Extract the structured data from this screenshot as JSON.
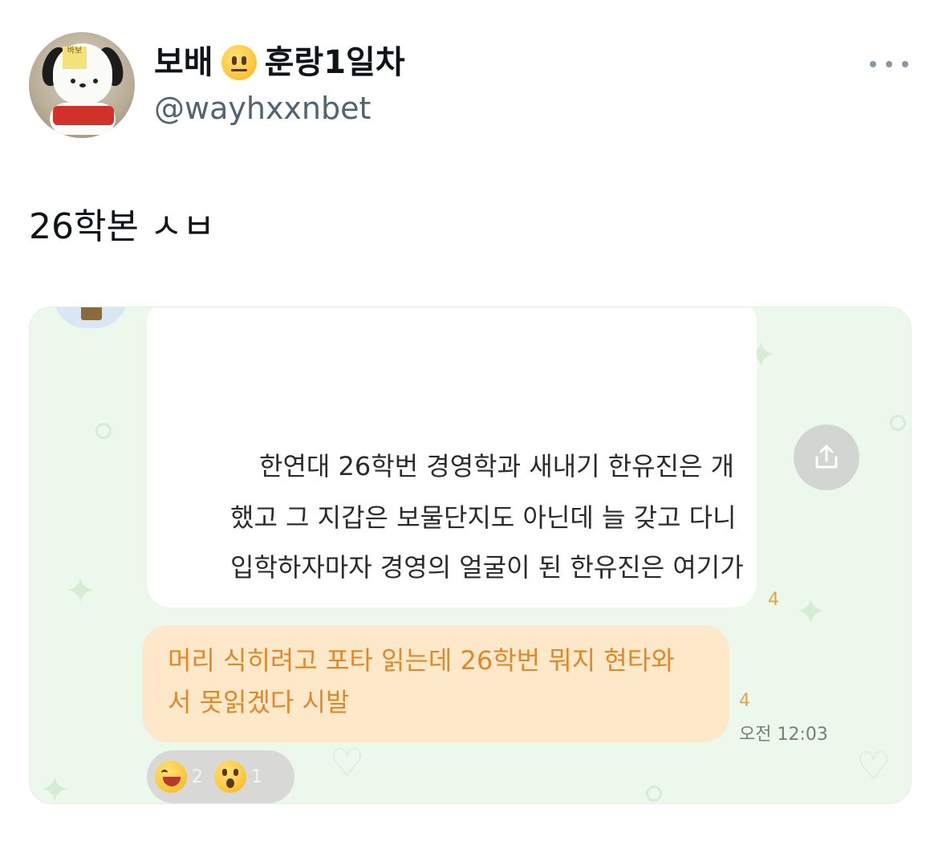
{
  "author": {
    "display_name_part1": "보배",
    "display_name_part2": "훈랑1일차",
    "handle": "@wayhxxnbet",
    "avatar_note_text": "바보"
  },
  "tweet": {
    "text": "26학본 ㅅㅂ"
  },
  "chat": {
    "message_lines": [
      "한연대 26학번 경영학과 새내기 한유진은 개",
      "했고 그 지갑은 보물단지도 아닌데 늘 갖고 다니",
      "입학하자마자 경영의 얼굴이 된 한유진은 여기가"
    ],
    "message_count": "4",
    "reply_lines": [
      "머리 식히려고 포타 읽는데 26학번 뭐지 현타와",
      "서 못읽겠다 시발"
    ],
    "reply_count": "4",
    "reply_time": "오전 12:03",
    "reactions": [
      {
        "icon": "grinning-squint-emoji",
        "count": "2"
      },
      {
        "icon": "astonished-emoji",
        "count": "1"
      }
    ]
  },
  "icons": {
    "more": "more-horizontal-icon",
    "share": "share-icon"
  },
  "colors": {
    "handle": "#536471",
    "chat_background": "#edf8ec",
    "reply_bubble": "#fde9c9",
    "reply_text": "#e0892b"
  }
}
